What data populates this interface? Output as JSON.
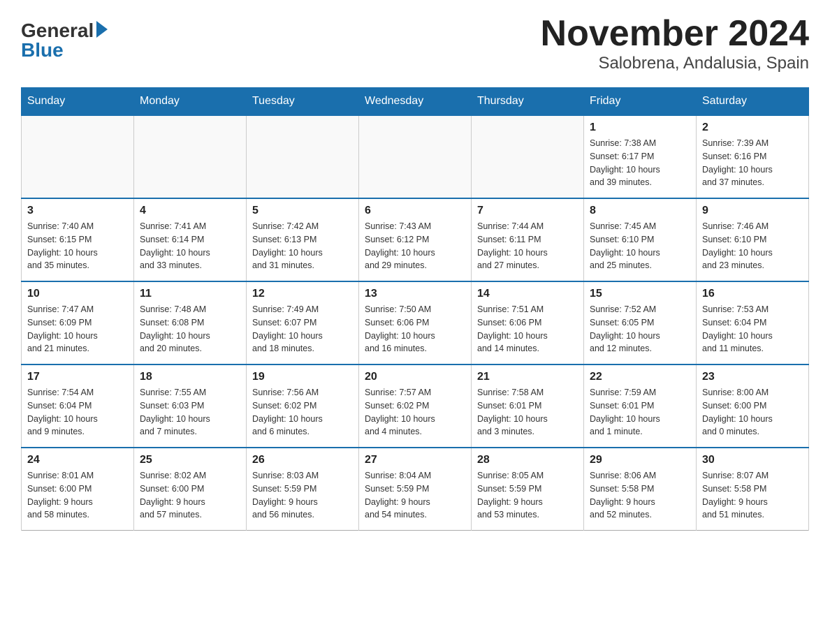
{
  "logo": {
    "general": "General",
    "blue": "Blue"
  },
  "title": "November 2024",
  "subtitle": "Salobrena, Andalusia, Spain",
  "weekdays": [
    "Sunday",
    "Monday",
    "Tuesday",
    "Wednesday",
    "Thursday",
    "Friday",
    "Saturday"
  ],
  "weeks": [
    [
      {
        "day": "",
        "info": ""
      },
      {
        "day": "",
        "info": ""
      },
      {
        "day": "",
        "info": ""
      },
      {
        "day": "",
        "info": ""
      },
      {
        "day": "",
        "info": ""
      },
      {
        "day": "1",
        "info": "Sunrise: 7:38 AM\nSunset: 6:17 PM\nDaylight: 10 hours\nand 39 minutes."
      },
      {
        "day": "2",
        "info": "Sunrise: 7:39 AM\nSunset: 6:16 PM\nDaylight: 10 hours\nand 37 minutes."
      }
    ],
    [
      {
        "day": "3",
        "info": "Sunrise: 7:40 AM\nSunset: 6:15 PM\nDaylight: 10 hours\nand 35 minutes."
      },
      {
        "day": "4",
        "info": "Sunrise: 7:41 AM\nSunset: 6:14 PM\nDaylight: 10 hours\nand 33 minutes."
      },
      {
        "day": "5",
        "info": "Sunrise: 7:42 AM\nSunset: 6:13 PM\nDaylight: 10 hours\nand 31 minutes."
      },
      {
        "day": "6",
        "info": "Sunrise: 7:43 AM\nSunset: 6:12 PM\nDaylight: 10 hours\nand 29 minutes."
      },
      {
        "day": "7",
        "info": "Sunrise: 7:44 AM\nSunset: 6:11 PM\nDaylight: 10 hours\nand 27 minutes."
      },
      {
        "day": "8",
        "info": "Sunrise: 7:45 AM\nSunset: 6:10 PM\nDaylight: 10 hours\nand 25 minutes."
      },
      {
        "day": "9",
        "info": "Sunrise: 7:46 AM\nSunset: 6:10 PM\nDaylight: 10 hours\nand 23 minutes."
      }
    ],
    [
      {
        "day": "10",
        "info": "Sunrise: 7:47 AM\nSunset: 6:09 PM\nDaylight: 10 hours\nand 21 minutes."
      },
      {
        "day": "11",
        "info": "Sunrise: 7:48 AM\nSunset: 6:08 PM\nDaylight: 10 hours\nand 20 minutes."
      },
      {
        "day": "12",
        "info": "Sunrise: 7:49 AM\nSunset: 6:07 PM\nDaylight: 10 hours\nand 18 minutes."
      },
      {
        "day": "13",
        "info": "Sunrise: 7:50 AM\nSunset: 6:06 PM\nDaylight: 10 hours\nand 16 minutes."
      },
      {
        "day": "14",
        "info": "Sunrise: 7:51 AM\nSunset: 6:06 PM\nDaylight: 10 hours\nand 14 minutes."
      },
      {
        "day": "15",
        "info": "Sunrise: 7:52 AM\nSunset: 6:05 PM\nDaylight: 10 hours\nand 12 minutes."
      },
      {
        "day": "16",
        "info": "Sunrise: 7:53 AM\nSunset: 6:04 PM\nDaylight: 10 hours\nand 11 minutes."
      }
    ],
    [
      {
        "day": "17",
        "info": "Sunrise: 7:54 AM\nSunset: 6:04 PM\nDaylight: 10 hours\nand 9 minutes."
      },
      {
        "day": "18",
        "info": "Sunrise: 7:55 AM\nSunset: 6:03 PM\nDaylight: 10 hours\nand 7 minutes."
      },
      {
        "day": "19",
        "info": "Sunrise: 7:56 AM\nSunset: 6:02 PM\nDaylight: 10 hours\nand 6 minutes."
      },
      {
        "day": "20",
        "info": "Sunrise: 7:57 AM\nSunset: 6:02 PM\nDaylight: 10 hours\nand 4 minutes."
      },
      {
        "day": "21",
        "info": "Sunrise: 7:58 AM\nSunset: 6:01 PM\nDaylight: 10 hours\nand 3 minutes."
      },
      {
        "day": "22",
        "info": "Sunrise: 7:59 AM\nSunset: 6:01 PM\nDaylight: 10 hours\nand 1 minute."
      },
      {
        "day": "23",
        "info": "Sunrise: 8:00 AM\nSunset: 6:00 PM\nDaylight: 10 hours\nand 0 minutes."
      }
    ],
    [
      {
        "day": "24",
        "info": "Sunrise: 8:01 AM\nSunset: 6:00 PM\nDaylight: 9 hours\nand 58 minutes."
      },
      {
        "day": "25",
        "info": "Sunrise: 8:02 AM\nSunset: 6:00 PM\nDaylight: 9 hours\nand 57 minutes."
      },
      {
        "day": "26",
        "info": "Sunrise: 8:03 AM\nSunset: 5:59 PM\nDaylight: 9 hours\nand 56 minutes."
      },
      {
        "day": "27",
        "info": "Sunrise: 8:04 AM\nSunset: 5:59 PM\nDaylight: 9 hours\nand 54 minutes."
      },
      {
        "day": "28",
        "info": "Sunrise: 8:05 AM\nSunset: 5:59 PM\nDaylight: 9 hours\nand 53 minutes."
      },
      {
        "day": "29",
        "info": "Sunrise: 8:06 AM\nSunset: 5:58 PM\nDaylight: 9 hours\nand 52 minutes."
      },
      {
        "day": "30",
        "info": "Sunrise: 8:07 AM\nSunset: 5:58 PM\nDaylight: 9 hours\nand 51 minutes."
      }
    ]
  ]
}
